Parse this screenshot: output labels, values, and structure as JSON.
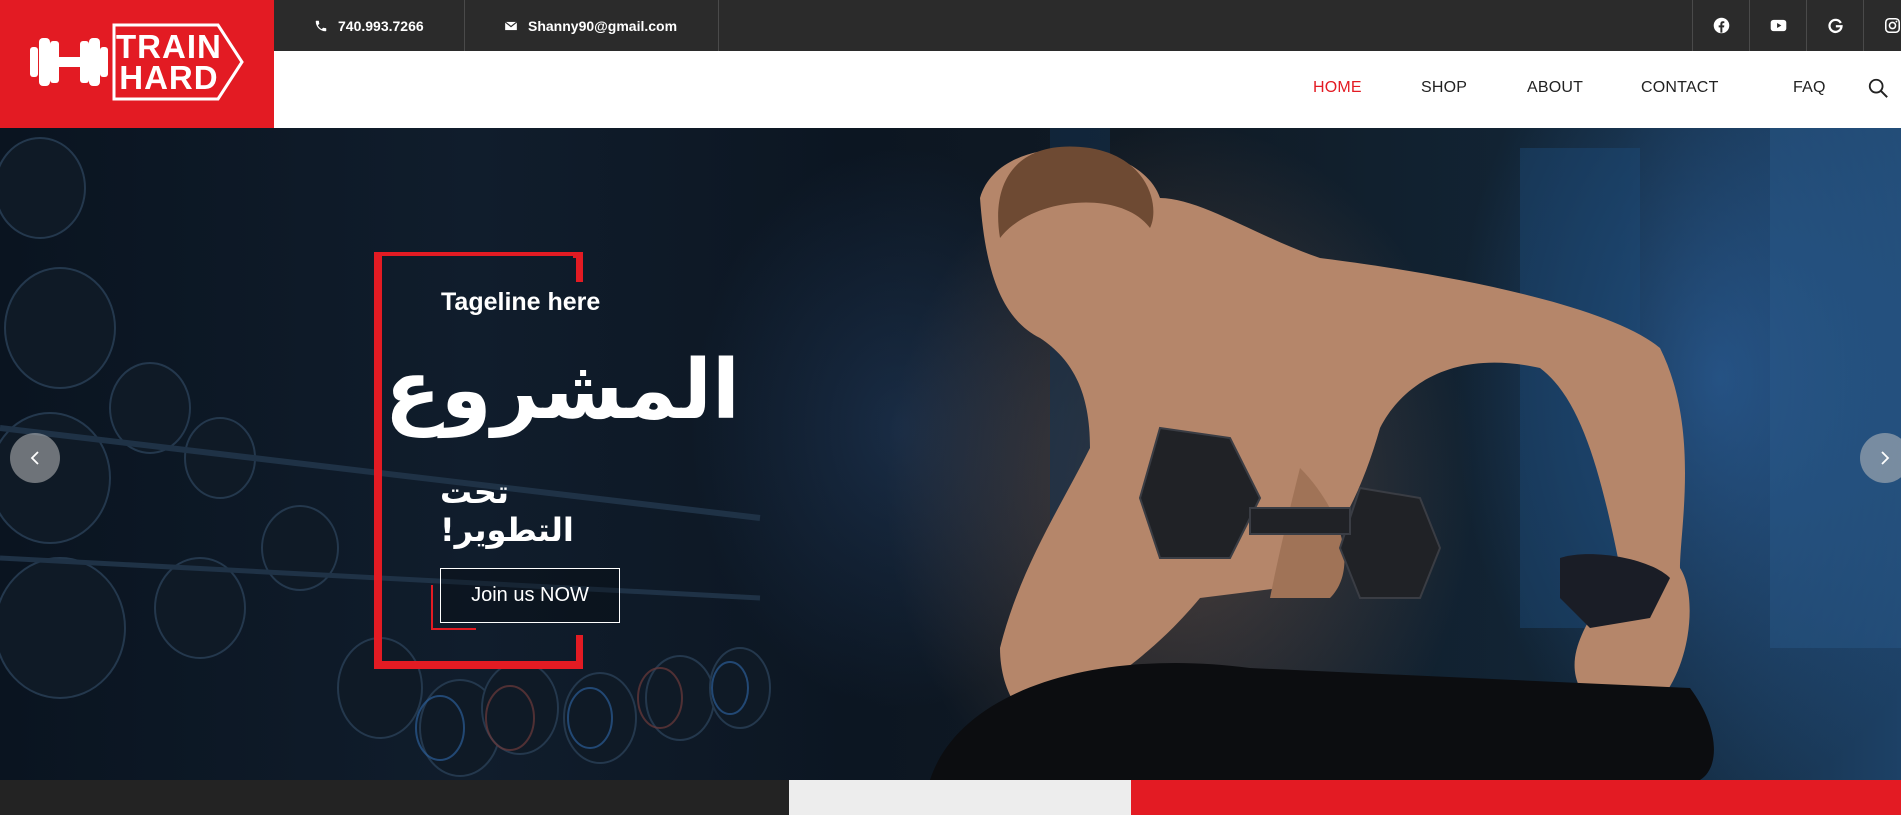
{
  "brand": {
    "line1": "TRAIN",
    "line2": "HARD",
    "color": "#e31b23"
  },
  "topbar": {
    "phone": "740.993.7266",
    "email": "Shanny90@gmail.com",
    "socials": [
      "facebook-icon",
      "youtube-icon",
      "google-icon",
      "instagram-icon"
    ]
  },
  "nav": {
    "items": [
      {
        "label": "HOME",
        "active": true
      },
      {
        "label": "SHOP"
      },
      {
        "label": "ABOUT"
      },
      {
        "label": "CONTACT"
      },
      {
        "label": "FAQ"
      }
    ],
    "search_icon": "search-icon"
  },
  "hero": {
    "tagline": "Tageline here",
    "headline": "المشروع",
    "subline": "تحت التطوير!",
    "cta": "Join us NOW",
    "prev_icon": "chevron-left-icon",
    "next_icon": "chevron-right-icon"
  },
  "colors": {
    "accent": "#e31b23",
    "topbar": "#2b2b2b",
    "strip_dark": "#232323",
    "strip_light": "#ededed"
  }
}
